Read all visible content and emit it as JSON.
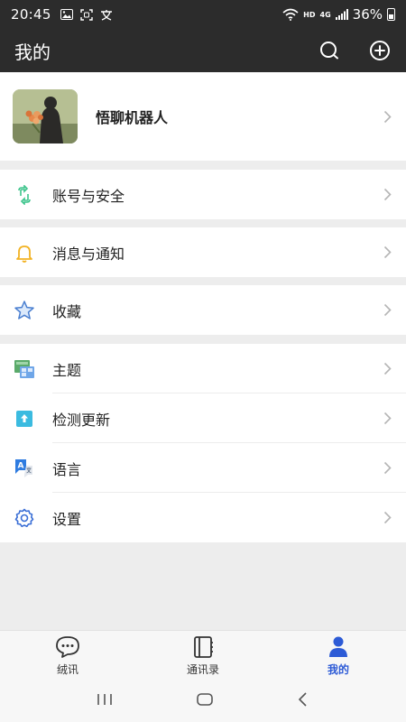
{
  "status_bar": {
    "time": "20:45",
    "network_label": "HD",
    "signal_label": "4G",
    "battery": "36%"
  },
  "header": {
    "title": "我的",
    "search_icon": "search-icon",
    "add_icon": "plus-circle-icon"
  },
  "profile": {
    "name": "悟聊机器人"
  },
  "menu_groups": [
    {
      "items": [
        {
          "label": "账号与安全",
          "icon": "shield-check-icon"
        }
      ]
    },
    {
      "items": [
        {
          "label": "消息与通知",
          "icon": "bell-icon"
        }
      ]
    },
    {
      "items": [
        {
          "label": "收藏",
          "icon": "star-icon"
        }
      ]
    },
    {
      "items": [
        {
          "label": "主题",
          "icon": "theme-icon"
        },
        {
          "label": "检测更新",
          "icon": "update-icon"
        },
        {
          "label": "语言",
          "icon": "language-icon"
        },
        {
          "label": "设置",
          "icon": "gear-icon"
        }
      ]
    }
  ],
  "tabs": [
    {
      "label": "绒讯",
      "icon": "chat-bubble-icon",
      "active": false
    },
    {
      "label": "通讯录",
      "icon": "contacts-icon",
      "active": false
    },
    {
      "label": "我的",
      "icon": "person-icon",
      "active": true
    }
  ],
  "colors": {
    "header_bg": "#2c2c2c",
    "active_tab": "#2d5bd6",
    "page_bg": "#ededed"
  }
}
